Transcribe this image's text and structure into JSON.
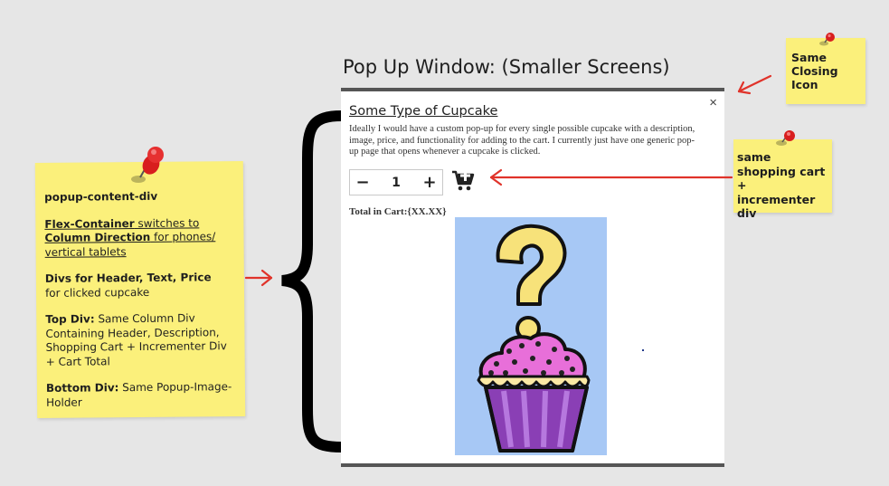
{
  "frame_title": "Pop Up Window: (Smaller Screens)",
  "popup": {
    "close_glyph": "×",
    "header": "Some Type of Cupcake",
    "description": "Ideally I would have a custom pop-up for every single possible cupcake with a description, image, price, and functionality for adding to the cart. I currently just have one generic pop-up page that opens whenever a cupcake is clicked.",
    "incrementer": {
      "minus": "−",
      "quantity": "1",
      "plus": "+"
    },
    "cart_icon": "add-to-cart-icon",
    "total_label": "Total in Cart:",
    "total_value": "{XX.XX}",
    "image": "question-mark-cupcake-image"
  },
  "notes": {
    "main": {
      "title": "popup-content-div",
      "p1_bold_1": "Flex-Container",
      "p1_text_1": " switches to ",
      "p1_bold_2": "Column Direction",
      "p1_text_2": " for phones/ vertical tablets",
      "p2_bold": "Divs for Header, Text, Price",
      "p2_text": "for clicked cupcake",
      "p3_bold": "Top Div:",
      "p3_text": " Same Column Div Containing Header, Description, Shopping Cart + Incrementer Div + Cart Total",
      "p4_bold": "Bottom Div:",
      "p4_text": " Same Popup-Image-Holder"
    },
    "closing_icon": "Same Closing Icon",
    "cart": "same shopping cart + incrementer div"
  },
  "colors": {
    "background": "#e6e6e6",
    "sticky": "#fbf07b",
    "pin": "#d81e1e",
    "arrow": "#e0332a",
    "image_bg": "#a7c8f5",
    "frosting": "#e86fd9",
    "wrapper": "#8a3fb5"
  }
}
